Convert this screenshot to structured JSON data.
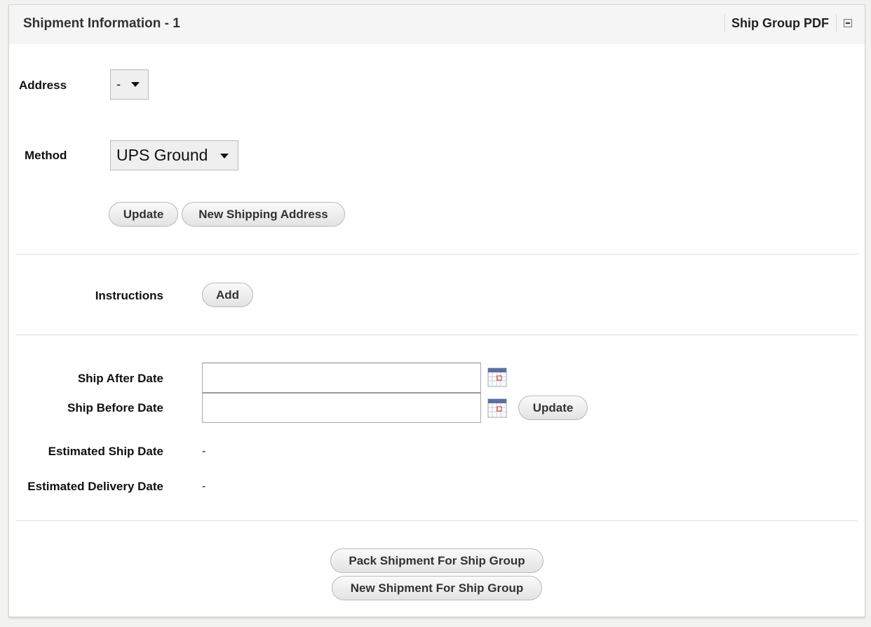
{
  "panel": {
    "title": "Shipment Information - 1",
    "pdf_link": "Ship Group PDF",
    "collapse_icon": "collapse-minus-icon"
  },
  "address": {
    "label": "Address",
    "selected": "-"
  },
  "method": {
    "label": "Method",
    "selected": "UPS Ground"
  },
  "address_buttons": {
    "update": "Update",
    "new_address": "New Shipping Address"
  },
  "instructions": {
    "label": "Instructions",
    "add": "Add"
  },
  "dates": {
    "ship_after_label": "Ship After Date",
    "ship_after_value": "",
    "ship_before_label": "Ship Before Date",
    "ship_before_value": "",
    "calendar_icon": "calendar-icon",
    "update": "Update",
    "estimated_ship_label": "Estimated Ship Date",
    "estimated_ship_value": "-",
    "estimated_delivery_label": "Estimated Delivery Date",
    "estimated_delivery_value": "-"
  },
  "actions": {
    "pack": "Pack Shipment For Ship Group",
    "new_shipment": "New Shipment For Ship Group"
  },
  "colors": {
    "header_bg": "#f5f5f5",
    "page_bg": "#f2f2f0",
    "button_border": "#b8b8b8"
  }
}
